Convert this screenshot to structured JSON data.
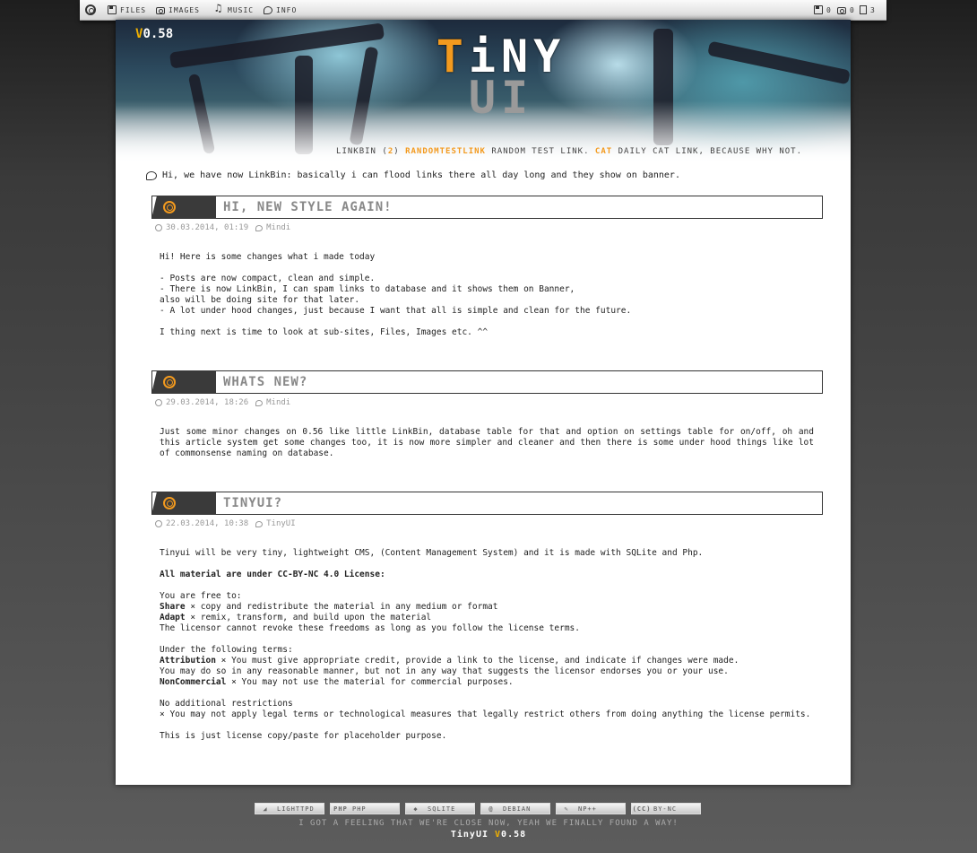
{
  "topbar": {
    "nav": [
      {
        "label": "Files",
        "icon": "floppy-icon"
      },
      {
        "label": "Images",
        "icon": "camera-icon"
      },
      {
        "label": "Music",
        "icon": "music-icon"
      },
      {
        "label": "Info",
        "icon": "speech-bubble-icon"
      }
    ],
    "stats": {
      "files": "0",
      "images": "0",
      "pages": "3"
    }
  },
  "banner": {
    "version_prefix": "V",
    "version_number": "0.58",
    "brand_line1_accent": "T",
    "brand_line1_rest": "iNY",
    "brand_line2": "UI",
    "linkbin_label": "LinkBin (",
    "linkbin_count": "2",
    "linkbin_close": ")",
    "links": [
      {
        "name": "RandomTestLink",
        "desc": "Random Test Link."
      },
      {
        "name": "Cat",
        "desc": "Daily cat link, because why not."
      }
    ]
  },
  "notice": "Hi, we have now LinkBin: basically i can flood links there all day long and they show on banner.",
  "articles": [
    {
      "title": "Hi, new style again!",
      "date": "30.03.2014, 01:19",
      "author": "Mindi",
      "lines": [
        "Hi! Here is some changes what i made today",
        "",
        "- Posts are now compact, clean and simple.",
        "- There is now LinkBin, I can spam links to database and it shows them on Banner,",
        "also will be doing site for that later.",
        "- A lot under hood changes, just because I want that all is simple and clean for the future.",
        "",
        "I thing next is time to look at sub-sites, Files, Images etc. ^^"
      ]
    },
    {
      "title": "Whats new?",
      "date": "29.03.2014, 18:26",
      "author": "Mindi",
      "paragraph": "Just some minor changes on 0.56 like little LinkBin, database table for that and option on settings table for on/off, oh and this article system get some changes too, it is now more simpler and cleaner and then there is some under hood things like lot of commonsense naming on database."
    },
    {
      "title": "TinyUI?",
      "date": "22.03.2014, 10:38",
      "author": "TinyUI",
      "intro": "Tinyui will be very tiny, lightweight CMS, (Content Management System) and it is made with SQLite and Php.",
      "license_heading": "All material are under CC-BY-NC 4.0 License:",
      "free_to": "You are free to:",
      "share_term": "Share",
      "share_text": " × copy and redistribute the material in any medium or format",
      "adapt_term": "Adapt",
      "adapt_text": " × remix, transform, and build upon the material",
      "cannot_revoke": "The licensor cannot revoke these freedoms as long as you follow the license terms.",
      "under_terms": "Under the following terms:",
      "attribution_term": "Attribution",
      "attribution_text": " × You must give appropriate credit, provide a link to the license, and indicate if changes were made.",
      "attribution_text2": "You may do so in any reasonable manner, but not in any way that suggests the licensor endorses you or your use.",
      "noncommercial_term": "NonCommercial",
      "noncommercial_text": " × You may not use the material for commercial purposes.",
      "no_additional": "No additional restrictions",
      "no_additional_text": "× You may not apply legal terms or technological measures that legally restrict others from doing anything the license permits.",
      "outro": "This is just license copy/paste for placeholder purpose."
    }
  ],
  "footer": {
    "badges": [
      {
        "icon": "feather-icon",
        "glyph": "◢",
        "label": "lighttpd"
      },
      {
        "icon": "php-icon",
        "glyph": "php",
        "label": "php"
      },
      {
        "icon": "sqlite-icon",
        "glyph": "◆",
        "label": "sqlite"
      },
      {
        "icon": "debian-icon",
        "glyph": "@",
        "label": "debian"
      },
      {
        "icon": "notepadpp-icon",
        "glyph": "✎",
        "label": "np++"
      },
      {
        "icon": "cc-icon",
        "glyph": "(cc)",
        "label": "by-nc"
      }
    ],
    "tagline": "I got a feeling that we're close now, yeah we finally found a way!",
    "name": "TinyUI",
    "version_prefix": "V",
    "version_number": "0.58"
  },
  "colors": {
    "accent": "#f39a1e",
    "version": "#f0b000",
    "header_dark": "#3a3a3a"
  }
}
